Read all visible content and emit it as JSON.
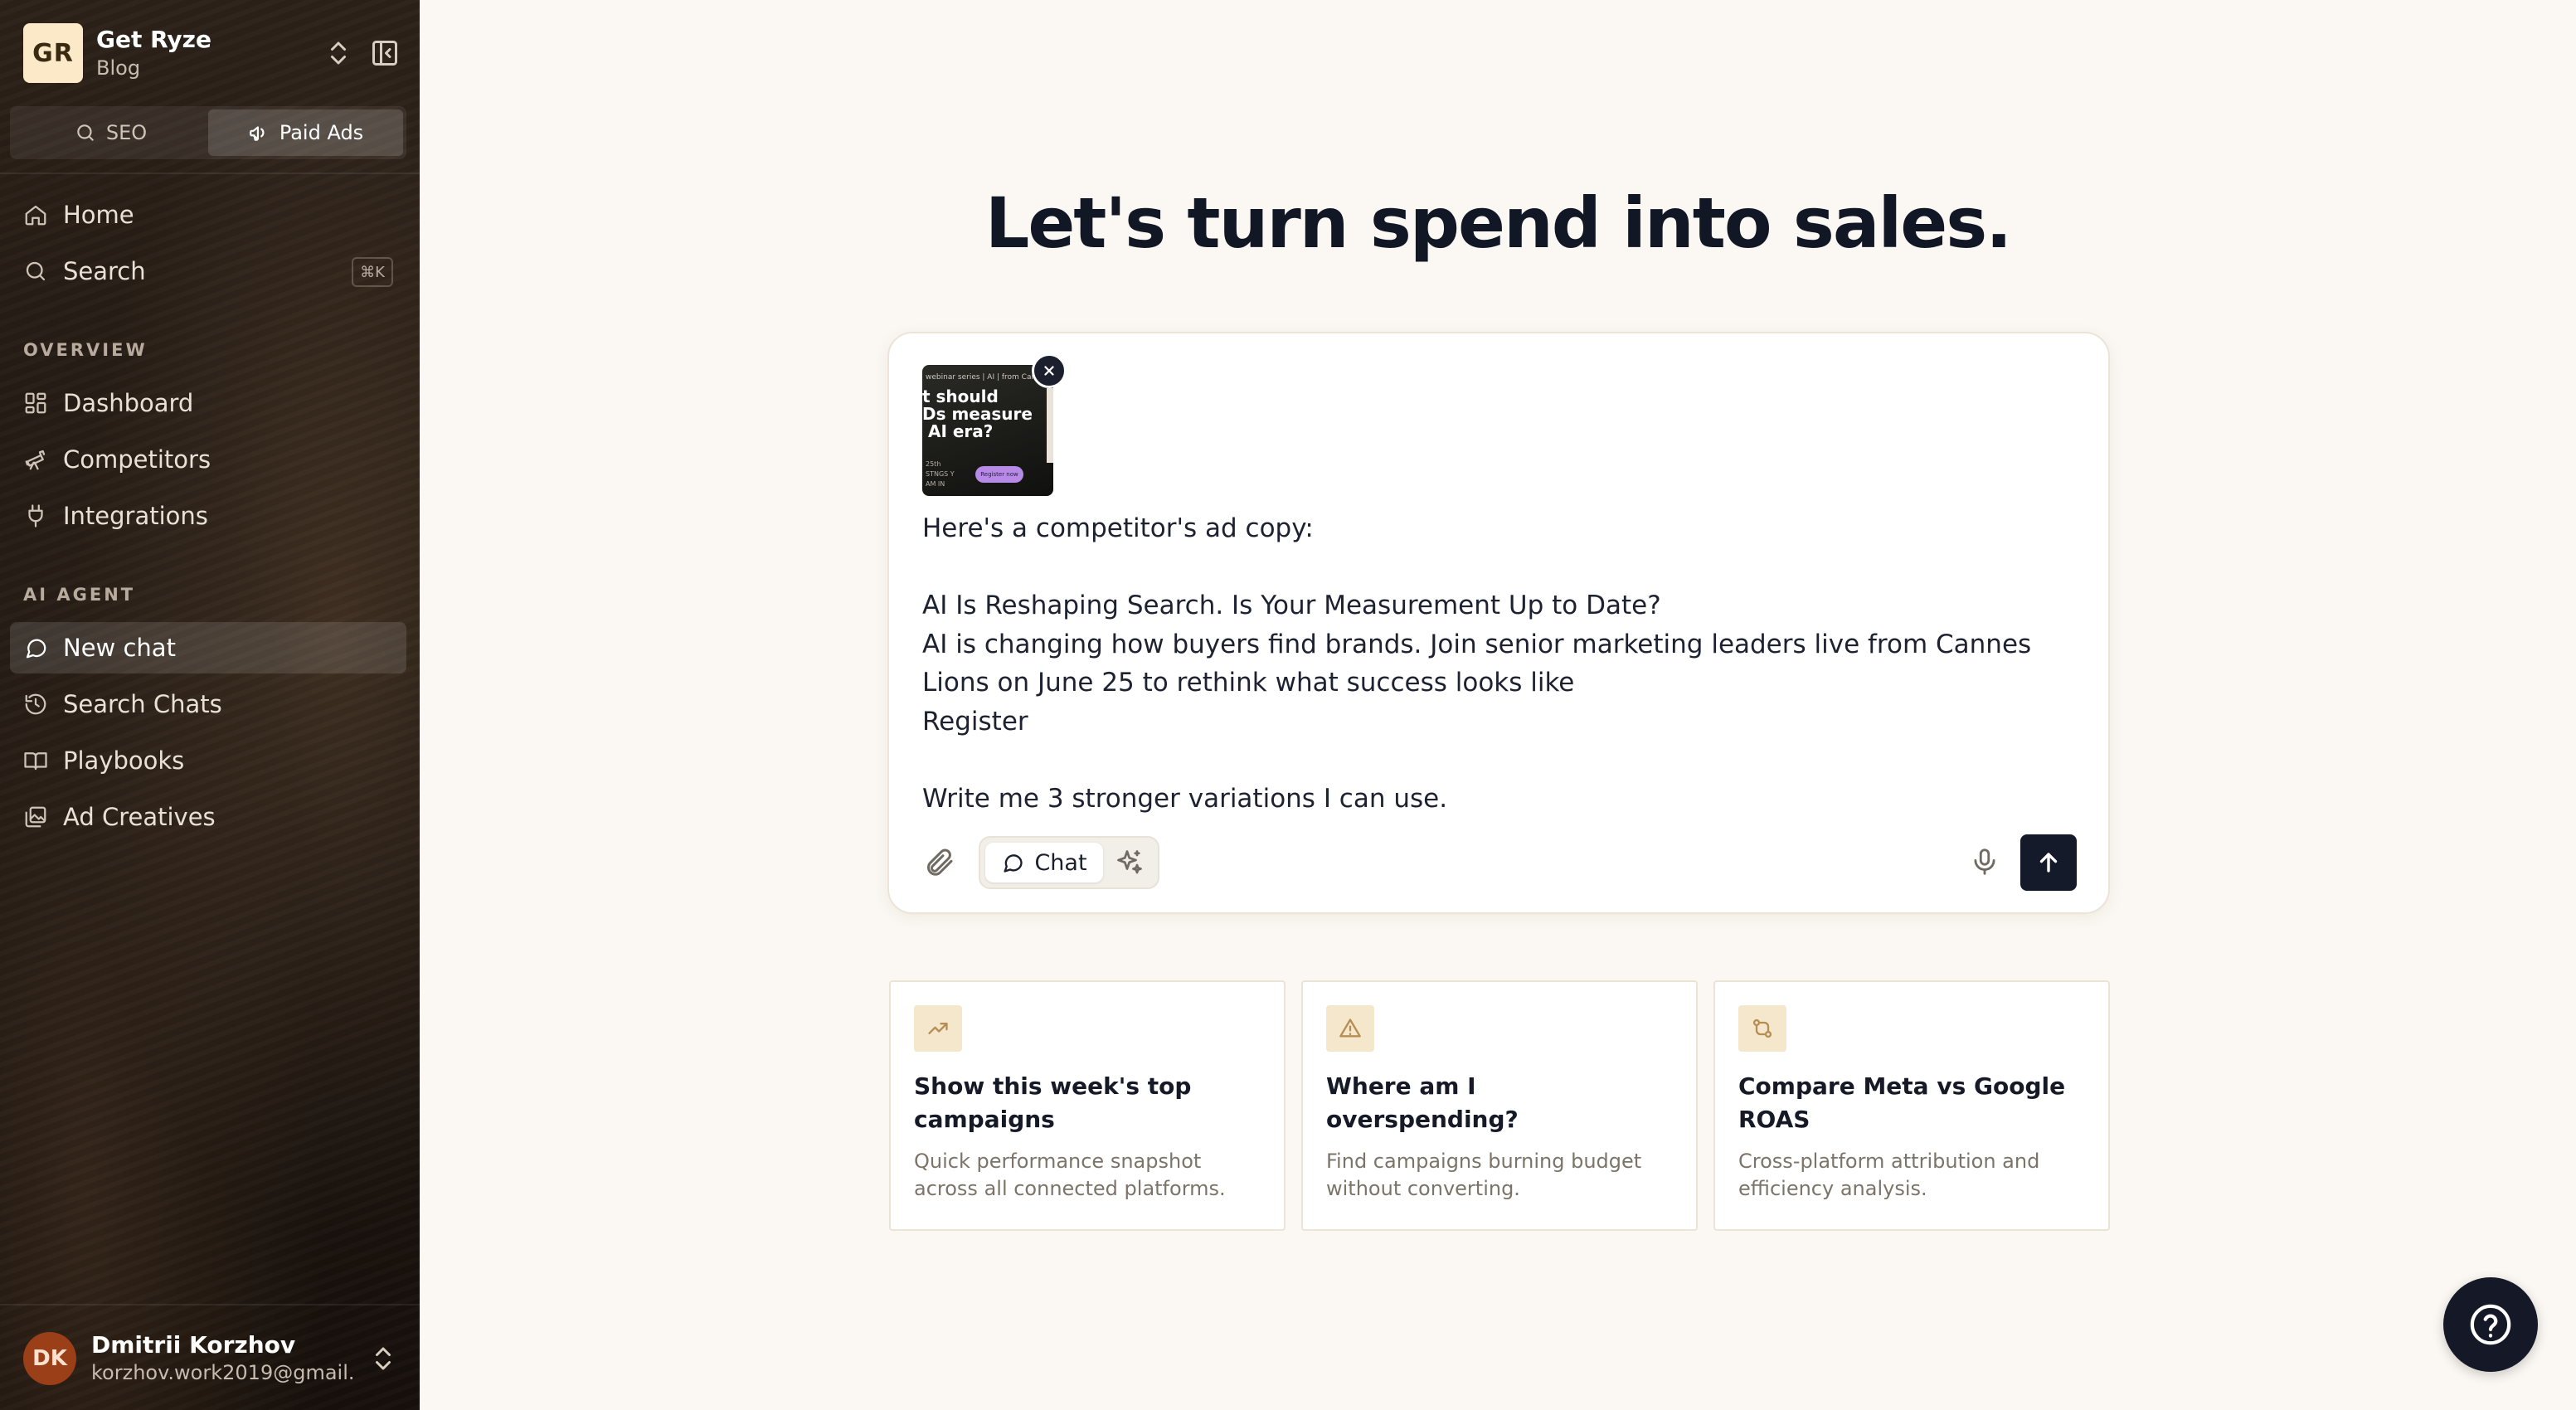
{
  "workspace": {
    "initials": "GR",
    "name": "Get Ryze",
    "subtitle": "Blog"
  },
  "mode_tabs": [
    {
      "label": "SEO",
      "icon": "search-icon",
      "active": false
    },
    {
      "label": "Paid Ads",
      "icon": "megaphone-icon",
      "active": true
    }
  ],
  "nav": {
    "home": "Home",
    "search": "Search",
    "search_shortcut": "⌘K"
  },
  "overview": {
    "label": "OVERVIEW",
    "items": [
      "Dashboard",
      "Competitors",
      "Integrations"
    ]
  },
  "ai_agent": {
    "label": "AI AGENT",
    "items": [
      "New chat",
      "Search Chats",
      "Playbooks",
      "Ad Creatives"
    ],
    "active_index": 0
  },
  "user": {
    "initials": "DK",
    "name": "Dmitrii Korzhov",
    "email": "korzhov.work2019@gmail...."
  },
  "main": {
    "headline": "Let's turn spend into sales.",
    "composer": {
      "message": "Here's a competitor's ad copy:\n\nAI Is Reshaping Search. Is Your Measurement Up to Date?\nAI is changing how buyers find brands. Join senior marketing leaders live from Cannes Lions on June 25 to rethink what success looks like\nRegister\n\nWrite me 3 stronger variations I can use.",
      "mode_label": "Chat",
      "attachment": {
        "small_text": "webinar series | AI | from Cannes Lions",
        "big_text": "t should\nDs measure\n AI era?",
        "foot_text": "25th\nSTNGS Y\nAM IN",
        "button_text": "Register now"
      }
    },
    "cards": [
      {
        "title": "Show this week's top campaigns",
        "desc": "Quick performance snapshot across all connected platforms.",
        "icon": "trending-up-icon"
      },
      {
        "title": "Where am I overspending?",
        "desc": "Find campaigns burning budget without converting.",
        "icon": "warning-icon"
      },
      {
        "title": "Compare Meta vs Google ROAS",
        "desc": "Cross-platform attribution and efficiency analysis.",
        "icon": "compare-icon"
      }
    ]
  },
  "colors": {
    "accent": "#151a2b",
    "card_icon_bg": "#f5e7cc",
    "sidebar_bg": "#1e1712",
    "background": "#fbf8f3"
  }
}
